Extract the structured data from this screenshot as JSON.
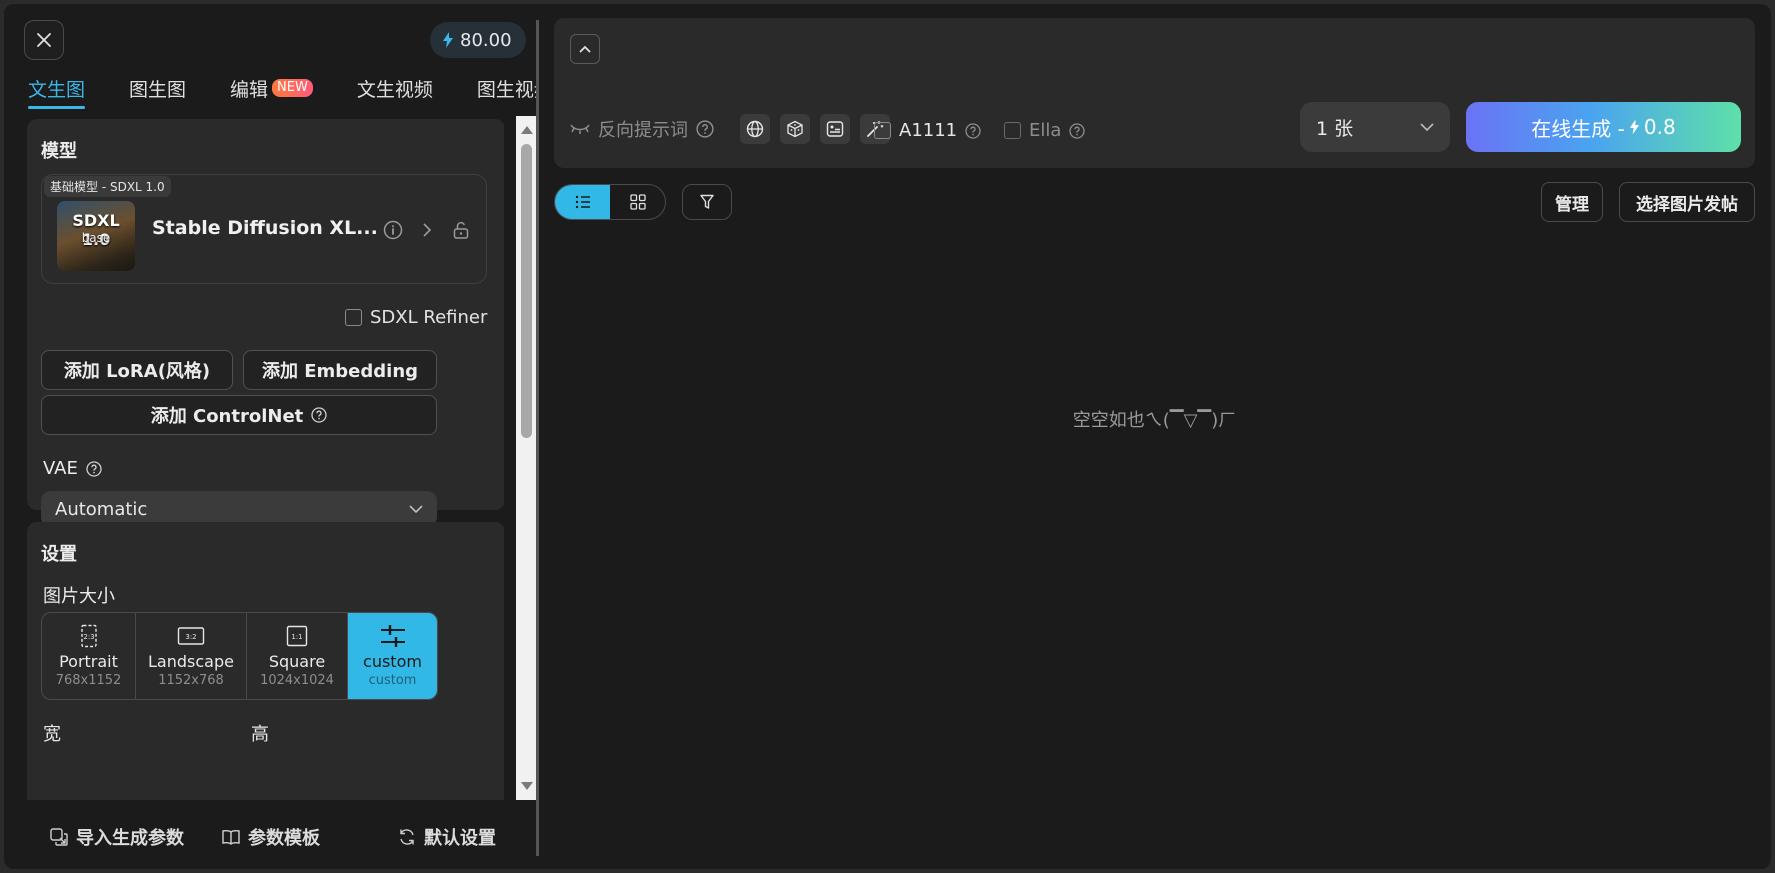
{
  "header": {
    "credits": "80.00"
  },
  "tabs": [
    {
      "label": "文生图"
    },
    {
      "label": "图生图"
    },
    {
      "label": "编辑",
      "badge": "NEW"
    },
    {
      "label": "文生视频"
    },
    {
      "label": "图生视频"
    }
  ],
  "model": {
    "section_title": "模型",
    "tag": "基础模型 - SDXL 1.0",
    "thumb_title": "SDXL 1.0",
    "thumb_sub": "base",
    "name": "Stable Diffusion XL..."
  },
  "refiner": {
    "label": "SDXL Refiner"
  },
  "buttons": {
    "add_lora": "添加 LoRA(风格)",
    "add_embedding": "添加 Embedding",
    "add_controlnet": "添加 ControlNet"
  },
  "vae": {
    "label": "VAE",
    "value": "Automatic"
  },
  "settings": {
    "title": "设置",
    "size_label": "图片大小",
    "sizes": [
      {
        "ratio": "2:3",
        "name": "Portrait",
        "dims": "768x1152"
      },
      {
        "ratio": "3:2",
        "name": "Landscape",
        "dims": "1152x768"
      },
      {
        "ratio": "1:1",
        "name": "Square",
        "dims": "1024x1024"
      },
      {
        "name": "custom",
        "dims": "custom"
      }
    ],
    "width_label": "宽",
    "height_label": "高"
  },
  "footer": {
    "import": "导入生成参数",
    "template": "参数模板",
    "default": "默认设置"
  },
  "prompt": {
    "negative_label": "反向提示词",
    "a1111": "A1111",
    "ella": "Ella",
    "count": "1 张",
    "generate": "在线生成 -",
    "generate_cost": "0.8"
  },
  "gallery": {
    "manage": "管理",
    "post": "选择图片发帖",
    "empty": "空空如也ㄟ(▔▽▔)ㄏ"
  },
  "colors": {
    "accent": "#32b8e6",
    "tab_active": "#3bb7e7"
  }
}
